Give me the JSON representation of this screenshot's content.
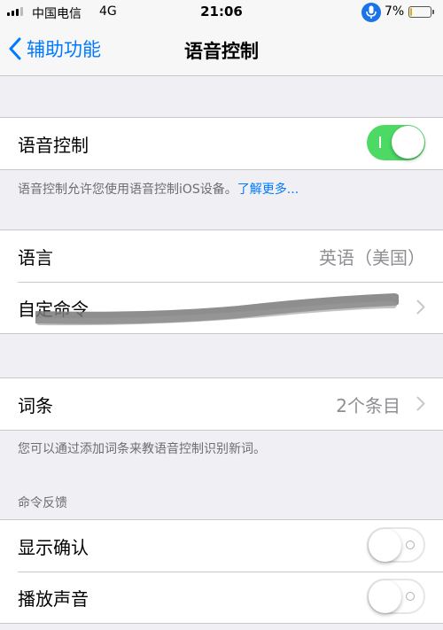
{
  "status_bar": {
    "carrier": "中国电信",
    "network": "4G",
    "time": "21:06",
    "battery_percent": "7%",
    "battery_level": 0.07,
    "mic_active_color": "#1a73e8"
  },
  "nav": {
    "back_label": "辅助功能",
    "title": "语音控制"
  },
  "voice_control": {
    "label": "语音控制",
    "enabled": true,
    "footer_text": "语音控制允许您使用语音控制iOS设备。",
    "learn_more": "了解更多..."
  },
  "settings": {
    "language_label": "语言",
    "language_value": "英语（美国）",
    "custom_commands_label": "自定命令"
  },
  "vocabulary": {
    "label": "词条",
    "value": "2个条目",
    "footer_text": "您可以通过添加词条来教语音控制识别新词。"
  },
  "command_feedback": {
    "header": "命令反馈",
    "items": [
      {
        "label": "显示确认",
        "enabled": false
      },
      {
        "label": "播放声音",
        "enabled": false
      }
    ]
  },
  "colors": {
    "accent": "#007aff",
    "toggle_on": "#4cd964",
    "background": "#efeff4"
  },
  "icons": [
    "signal-icon",
    "microphone-icon",
    "battery-icon",
    "chevron-left-icon",
    "chevron-right-icon"
  ]
}
